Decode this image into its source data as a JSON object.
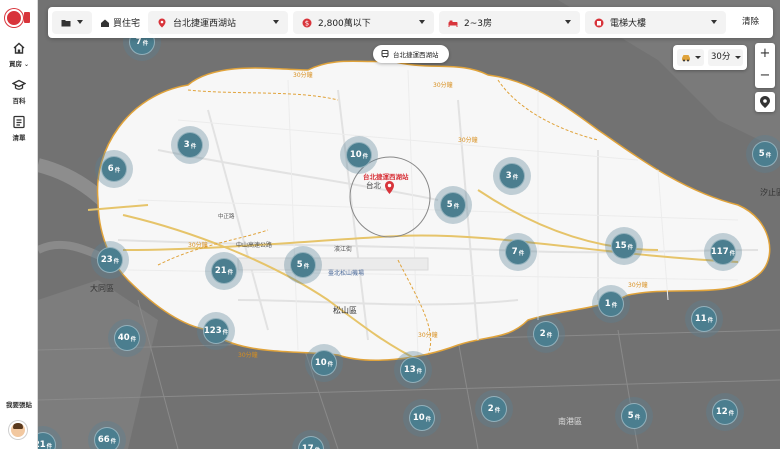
{
  "sidebar": {
    "items": [
      {
        "label": "買房",
        "icon": "house-icon",
        "has_chevron": true
      },
      {
        "label": "百科",
        "icon": "graduation-cap-icon"
      },
      {
        "label": "清單",
        "icon": "list-icon"
      }
    ],
    "help_label": "我要張貼"
  },
  "filters": {
    "mode_label": "買住宅",
    "location": "台北捷運西湖站",
    "price": "2,800萬以下",
    "rooms": "2~3房",
    "building_type": "電梯大樓",
    "clear_label": "清除"
  },
  "station_chip": "台北捷運西湖站",
  "commute": {
    "time": "30分",
    "mode_icon": "car-icon"
  },
  "zoom": {
    "in": "+",
    "out": "−"
  },
  "map": {
    "station_label": "台北捷運西湖站",
    "station_sub": "台北",
    "labels": [
      {
        "text": "大同區"
      },
      {
        "text": "松山區"
      },
      {
        "text": "中山高速公路"
      },
      {
        "text": "濱江街"
      },
      {
        "text": "臺北松山機場"
      },
      {
        "text": "南港區"
      },
      {
        "text": "汐止區"
      },
      {
        "text": "中正路"
      }
    ],
    "isochrone_labels": [
      "30分鐘",
      "30分鐘",
      "30分鐘",
      "30分鐘",
      "30分鐘",
      "30分鐘",
      "30分鐘"
    ]
  },
  "clusters": [
    {
      "count": "7",
      "unit": "件"
    },
    {
      "count": "3",
      "unit": "件"
    },
    {
      "count": "10",
      "unit": "件"
    },
    {
      "count": "6",
      "unit": "件"
    },
    {
      "count": "3",
      "unit": "件"
    },
    {
      "count": "5",
      "unit": "件"
    },
    {
      "count": "5",
      "unit": "件"
    },
    {
      "count": "23",
      "unit": "件"
    },
    {
      "count": "21",
      "unit": "件"
    },
    {
      "count": "5",
      "unit": "件"
    },
    {
      "count": "7",
      "unit": "件"
    },
    {
      "count": "15",
      "unit": "件"
    },
    {
      "count": "117",
      "unit": "件"
    },
    {
      "count": "1",
      "unit": "件"
    },
    {
      "count": "11",
      "unit": "件"
    },
    {
      "count": "40",
      "unit": "件"
    },
    {
      "count": "123",
      "unit": "件"
    },
    {
      "count": "2",
      "unit": "件"
    },
    {
      "count": "10",
      "unit": "件"
    },
    {
      "count": "13",
      "unit": "件"
    },
    {
      "count": "10",
      "unit": "件"
    },
    {
      "count": "2",
      "unit": "件"
    },
    {
      "count": "5",
      "unit": "件"
    },
    {
      "count": "12",
      "unit": "件"
    },
    {
      "count": "66",
      "unit": "件"
    },
    {
      "count": "21",
      "unit": "件"
    },
    {
      "count": "17",
      "unit": "件"
    }
  ],
  "colors": {
    "brand": "#d8343b",
    "cluster": "#4b7e8f",
    "isochrone_border": "#e0a33b",
    "map_inside": "#f7f7f7",
    "map_outside": "#6b6b6b"
  }
}
